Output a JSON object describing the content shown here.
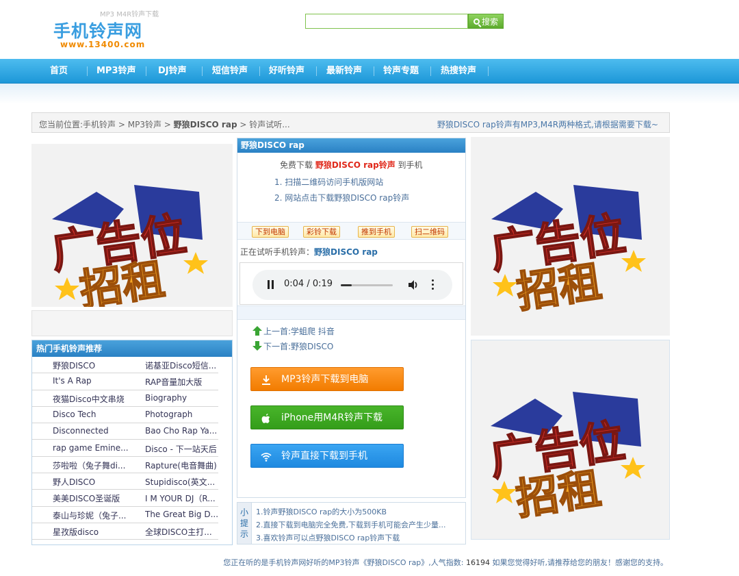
{
  "header": {
    "slogan": "MP3 M4R铃声下载",
    "site_name": "手机铃声网",
    "site_url": "www.13400.com",
    "search_placeholder": "",
    "search_label": "搜索"
  },
  "nav": {
    "items": [
      "首页",
      "MP3铃声",
      "DJ铃声",
      "短信铃声",
      "好听铃声",
      "最新铃声",
      "铃声专题",
      "热搜铃声"
    ]
  },
  "breadcrumb": {
    "prefix": "您当前位置:",
    "items": [
      "手机铃声",
      "MP3铃声",
      "野狼DISCO rap",
      "铃声试听..."
    ],
    "separator": " > ",
    "notice": "野狼DISCO rap铃声有MP3,M4R两种格式,请根据需要下载~"
  },
  "hot": {
    "title": "热门手机铃声推荐",
    "rows": [
      [
        "野狼DISCO",
        "诺基亚Disco短信..."
      ],
      [
        "It's A Rap",
        "RAP音量加大版"
      ],
      [
        "夜猫Disco中文串烧",
        "Biography"
      ],
      [
        "Disco Tech",
        "Photograph"
      ],
      [
        "Disconnected",
        "Bao Cho Rap Ya..."
      ],
      [
        "rap game Emine...",
        "Disco - 下一站天后"
      ],
      [
        "莎啦啦（兔子舞di...",
        "Rapture(电音舞曲)"
      ],
      [
        "野人DISCO",
        "Stupidisco(英文..."
      ],
      [
        "美美DISCO圣诞版",
        "I M YOUR DJ（R..."
      ],
      [
        "泰山与珍妮（兔子...",
        "The Great Big D..."
      ],
      [
        "星孜版disco",
        "全球DISCO主打..."
      ]
    ]
  },
  "center": {
    "title": "野狼DISCO rap",
    "free_prefix": "免费下载",
    "free_song": "野狼DISCO rap铃声",
    "free_suffix": "到手机",
    "steps": [
      "1. 扫描二维码访问手机版网站",
      "2. 网站点击下载野狼DISCO rap铃声"
    ],
    "ops": [
      "下到电脑",
      "彩铃下载",
      "推到手机",
      "扫二维码"
    ],
    "now_playing_label": "正在试听手机铃声：",
    "now_playing_song": "野狼DISCO rap",
    "audio": {
      "time": "0:04 / 0:19",
      "progress": 0.21
    },
    "prev": "上一首:学蛆爬 抖音",
    "next": "下一首:野狼DISCO",
    "downloads": [
      "MP3铃声下载到电脑",
      "iPhone用M4R铃声下载",
      "铃声直接下载到手机"
    ],
    "colors": {
      "orange": "#f58a0e",
      "green": "#3ea821",
      "blue": "#2a95ea"
    }
  },
  "tips": {
    "label": "小提示",
    "items": [
      "1.铃声野狼DISCO rap的大小为500KB",
      "2.直接下载到电脑完全免费,下载到手机可能会产生少量...",
      "3.喜欢铃声可以点野狼DISCO rap铃声下载"
    ]
  },
  "ads": {
    "line1": "广告位",
    "line2": "招租"
  },
  "footer": {
    "pre": "您正在听的是手机铃声网好听的MP3铃声《野狼DISCO rap》,人气指数: ",
    "count": "16194",
    "post": " 如果您觉得好听,请推荐给您的朋友！感谢您的支持。"
  }
}
